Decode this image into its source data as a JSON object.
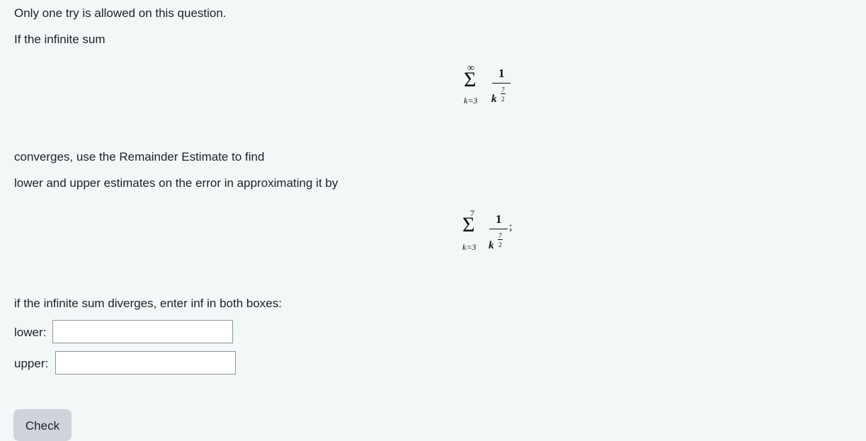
{
  "question": {
    "notice": "Only one try is allowed on this question.",
    "intro": "If the infinite sum",
    "converges_text": "converges, use the Remainder Estimate to find",
    "estimates_text": "lower and upper estimates on the error in approximating it by",
    "diverges_text": "if the infinite sum diverges, enter inf in both boxes:",
    "sum1": {
      "upper_limit": "∞",
      "lower_limit": "k=3",
      "numerator": "1",
      "base": "k",
      "exponent_numerator": "7",
      "exponent_denominator": "2",
      "trailing": ""
    },
    "sum2": {
      "upper_limit": "7",
      "lower_limit": "k=3",
      "numerator": "1",
      "base": "k",
      "exponent_numerator": "7",
      "exponent_denominator": "2",
      "trailing": ";"
    }
  },
  "form": {
    "lower_label": "lower:",
    "lower_value": "",
    "upper_label": "upper:",
    "upper_value": "",
    "check_label": "Check"
  }
}
